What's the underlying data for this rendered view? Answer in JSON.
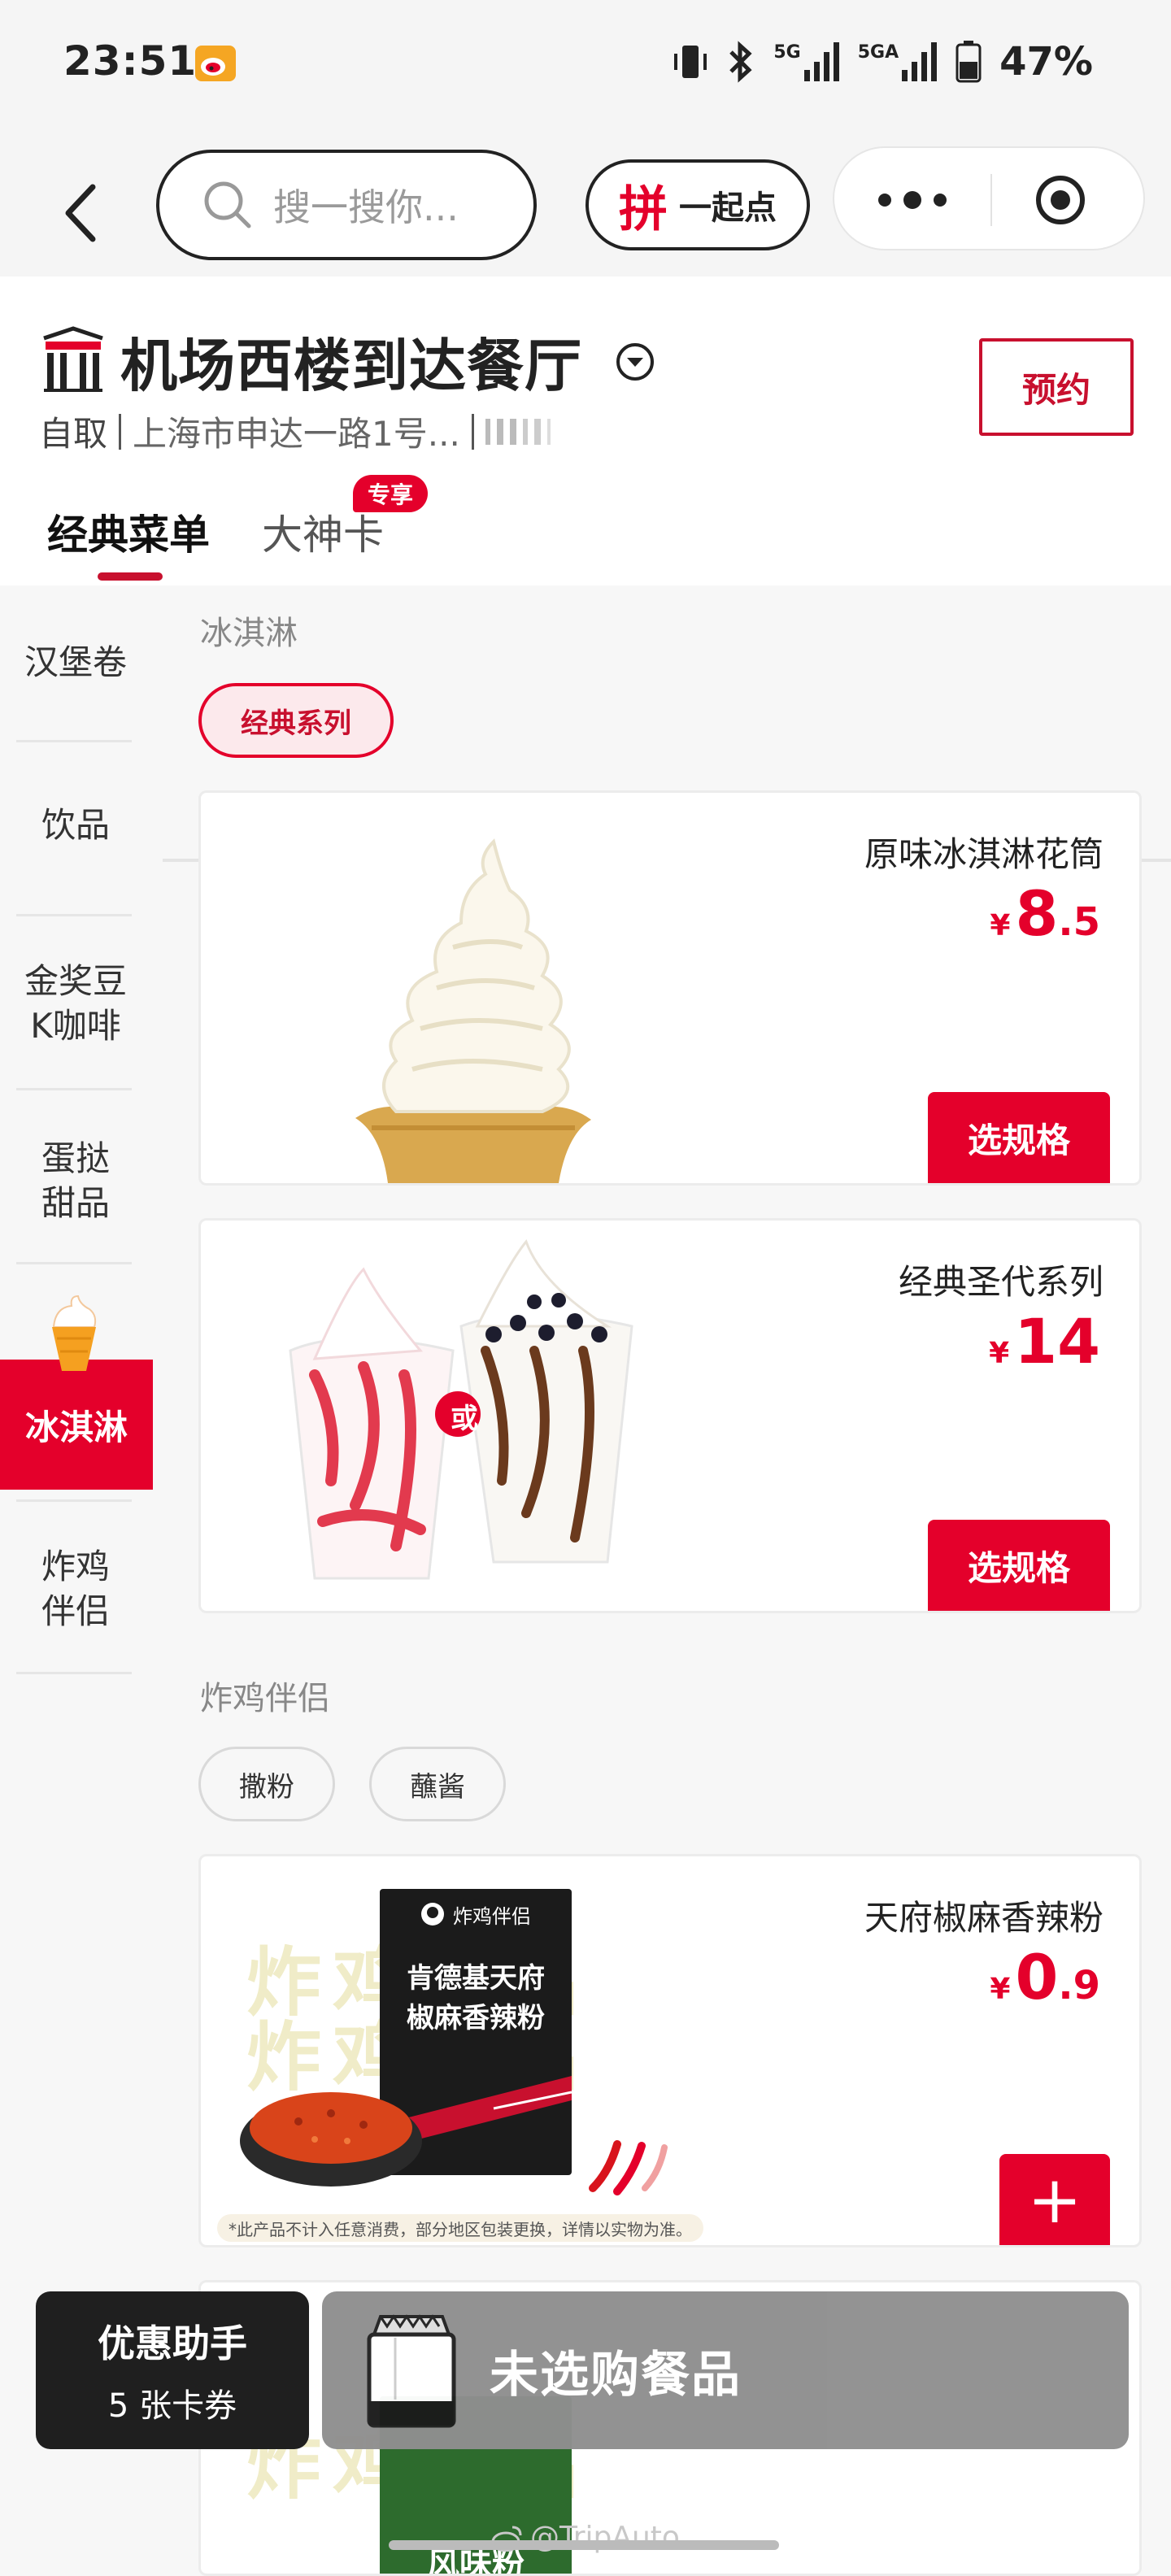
{
  "status_bar": {
    "time": "23:51",
    "network_5g": "5G",
    "network_5ga": "5GA",
    "battery": "47%"
  },
  "nav": {
    "search_placeholder": "搜一搜你...",
    "group_order_char": "拼",
    "group_order_label": "一起点"
  },
  "store": {
    "name": "机场西楼到达餐厅",
    "mode": "自取",
    "address": "上海市申达一路1号...",
    "reserve_label": "预约"
  },
  "tabs": {
    "classic_menu": "经典菜单",
    "god_card": "大神卡",
    "god_card_badge": "专享"
  },
  "sidebar": {
    "items": [
      "汉堡卷",
      "饮品",
      "金奖豆K咖啡",
      "蛋挞甜品",
      "冰淇淋",
      "炸鸡伴侣"
    ],
    "item_lines": {
      "coffee_line1": "金奖豆",
      "coffee_line2": "K咖啡",
      "tart_line1": "蛋挞",
      "tart_line2": "甜品",
      "chicken_line1": "炸鸡",
      "chicken_line2": "伴侣"
    },
    "active": "冰淇淋"
  },
  "sections": {
    "ice_cream": {
      "title": "冰淇淋",
      "chip": "经典系列"
    },
    "chicken_partner": {
      "title": "炸鸡伴侣",
      "chip1": "撒粉",
      "chip2": "蘸酱"
    }
  },
  "products": {
    "cone": {
      "name": "原味冰淇淋花筒",
      "yen": "¥",
      "price_int": "8",
      "price_dec": ".5",
      "action": "选规格"
    },
    "sundae": {
      "name": "经典圣代系列",
      "yen": "¥",
      "price_int": "14",
      "price_dec": "",
      "action": "选规格",
      "or_label": "或"
    },
    "spice": {
      "name": "天府椒麻香辣粉",
      "yen": "¥",
      "price_int": "0",
      "price_dec": ".9",
      "action": "+",
      "pack_brand": "炸鸡伴侣",
      "pack_line1": "肯德基天府",
      "pack_line2": "椒麻香辣粉",
      "bg_text": "炸鸡伴侣",
      "disclaimer": "*此产品不计入任意消费，部分地区包装更换，详情以实物为准。"
    },
    "next": {
      "pack_text": "风味粉",
      "bg_text": "炸鸡伴侣"
    }
  },
  "bottom": {
    "coupon_title": "优惠助手",
    "coupon_count": "5 张卡券",
    "cart_text": "未选购餐品"
  },
  "watermark": "@TripAuto",
  "colors": {
    "accent": "#e4002b",
    "accent_dark": "#c8102e"
  },
  "icons": [
    "weibo-icon",
    "back-icon",
    "search-icon",
    "more-icon",
    "target-icon",
    "store-logo-icon",
    "chevron-down-icon",
    "ice-cream-icon",
    "shopping-bag-icon"
  ]
}
